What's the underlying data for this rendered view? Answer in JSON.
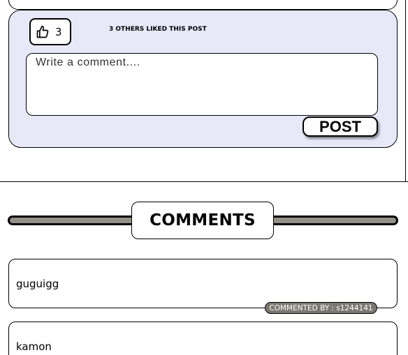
{
  "post": {
    "like_count": "3",
    "likes_text": "3 OTHERS LIKED THIS POST",
    "comment_placeholder": "Write a comment....",
    "post_label": "POST"
  },
  "comments_section": {
    "heading": "COMMENTS",
    "items": [
      {
        "text": "guguigg",
        "author_label": "COMMENTED BY : s1244141"
      },
      {
        "text": "kamon"
      }
    ]
  },
  "colors": {
    "panel_background": "#e8e8f9",
    "rail": "#919187",
    "author_badge": "#7a7a72"
  },
  "icons": {
    "like": "thumbs-up-icon"
  }
}
